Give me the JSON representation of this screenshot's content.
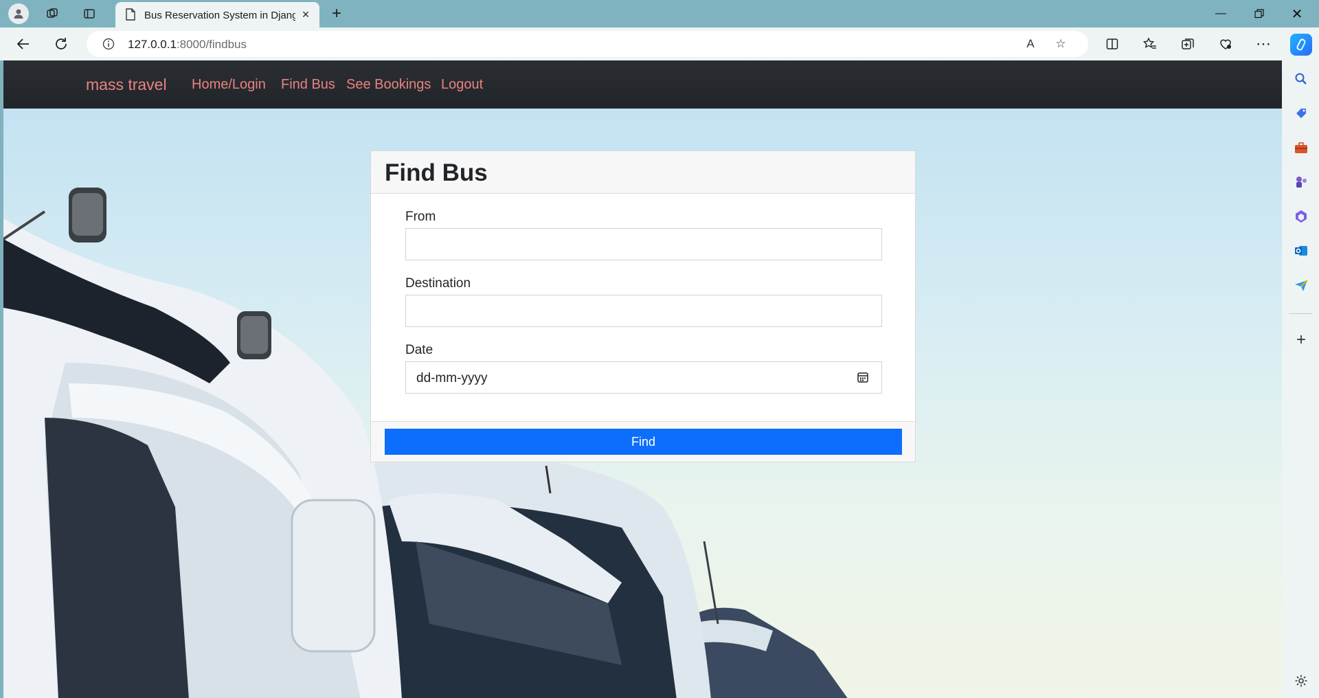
{
  "browser": {
    "tab_title": "Bus Reservation System in Djang",
    "url_host": "127.0.0.1",
    "url_rest": ":8000/findbus"
  },
  "site": {
    "brand": "mass travel",
    "nav": [
      "Home/Login",
      "Find Bus",
      "See Bookings",
      "Logout"
    ]
  },
  "form": {
    "title": "Find Bus",
    "from_label": "From",
    "destination_label": "Destination",
    "date_label": "Date",
    "date_placeholder": "dd-mm-yyyy",
    "submit_label": "Find"
  },
  "colors": {
    "navbar": "#212529",
    "nav_link": "#e98282",
    "primary": "#0d6efd"
  }
}
